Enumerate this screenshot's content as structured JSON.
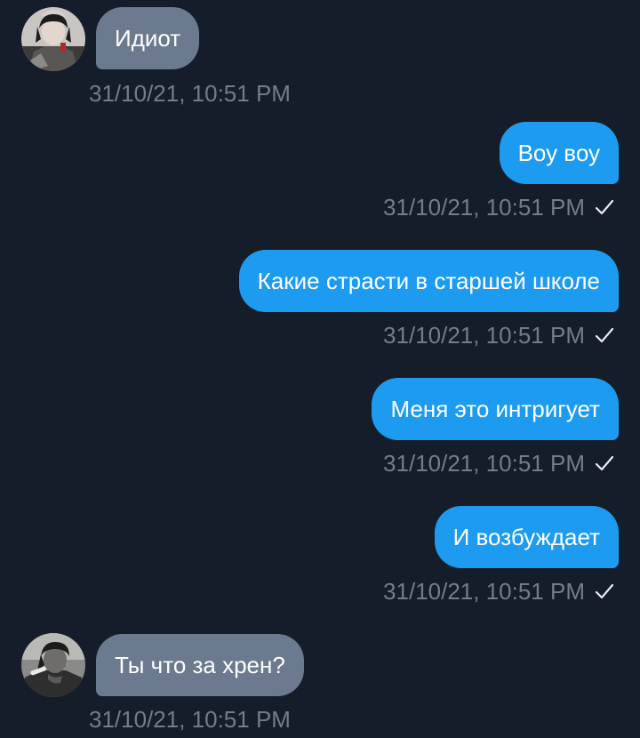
{
  "messages": [
    {
      "direction": "incoming",
      "text": "Идиот",
      "timestamp": "31/10/21, 10:51 PM"
    },
    {
      "direction": "outgoing",
      "text": "Воу воу",
      "timestamp": "31/10/21, 10:51 PM"
    },
    {
      "direction": "outgoing",
      "text": "Какие страсти в старшей школе",
      "timestamp": "31/10/21, 10:51 PM"
    },
    {
      "direction": "outgoing",
      "text": "Меня это интригует",
      "timestamp": "31/10/21, 10:51 PM"
    },
    {
      "direction": "outgoing",
      "text": "И возбуждает",
      "timestamp": "31/10/21, 10:51 PM"
    },
    {
      "direction": "incoming",
      "text": "Ты что за хрен?",
      "timestamp": "31/10/21, 10:51 PM"
    }
  ],
  "icons": {
    "sent_status": "checkmark-icon",
    "avatar": "user-avatar"
  },
  "colors": {
    "background": "#151d2a",
    "incoming_bubble": "#6b7a8e",
    "outgoing_bubble": "#1d9bf0",
    "timestamp": "#6f7d8e",
    "text": "#ffffff"
  }
}
